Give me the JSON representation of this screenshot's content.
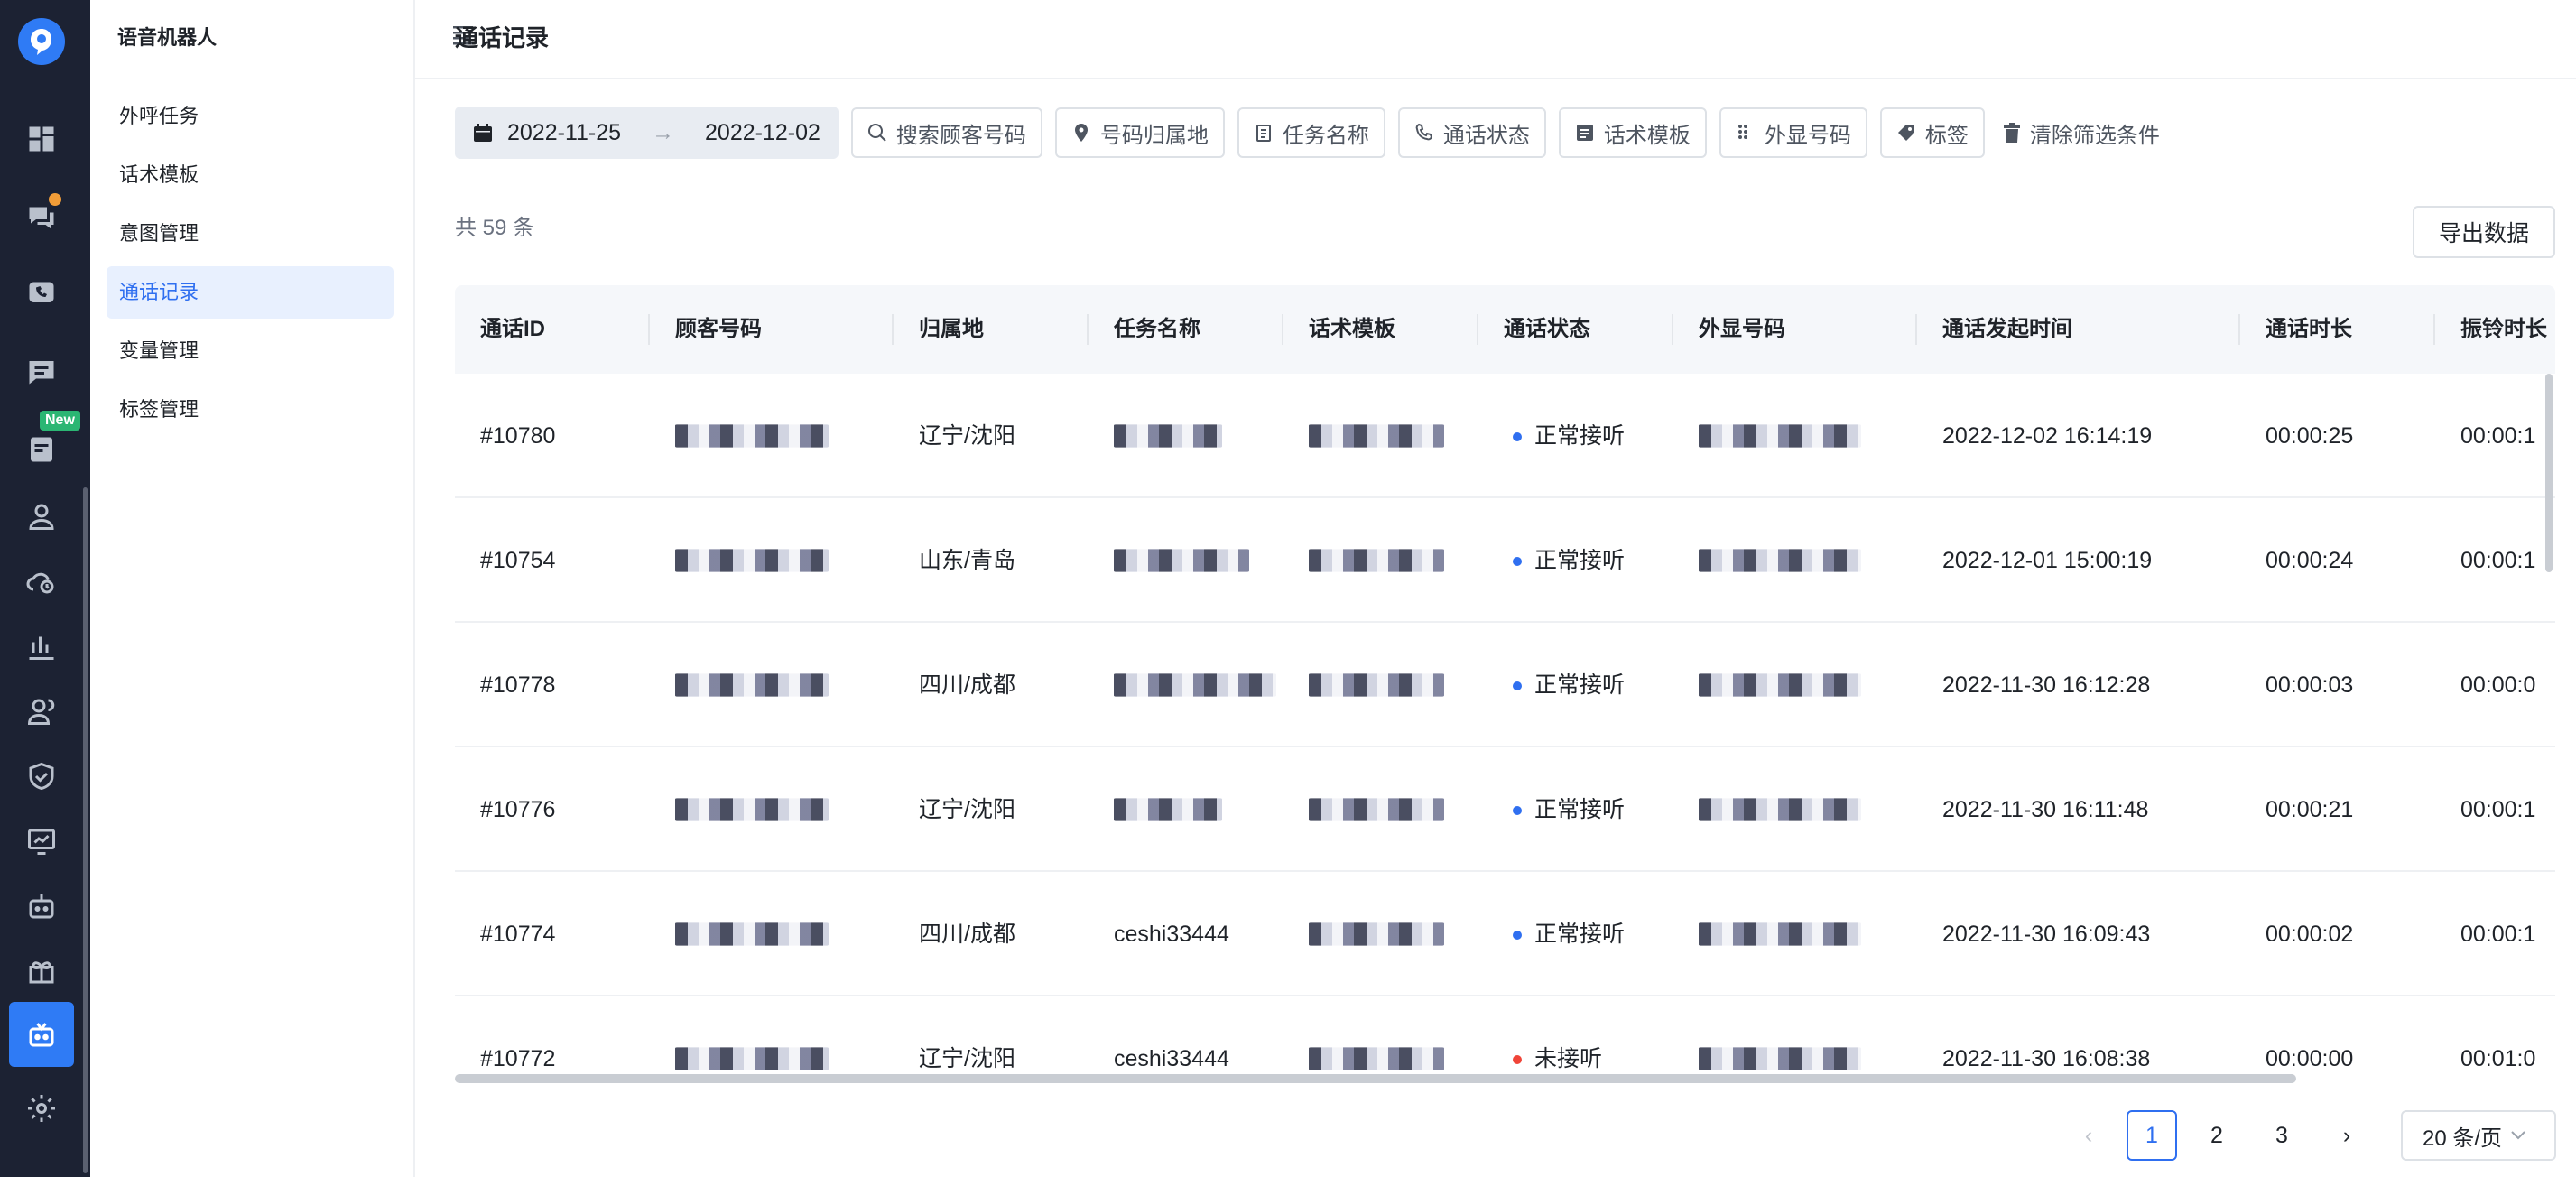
{
  "sidebar": {
    "app_title": "语音机器人",
    "items": [
      {
        "label": "外呼任务",
        "active": false
      },
      {
        "label": "话术模板",
        "active": false
      },
      {
        "label": "意图管理",
        "active": false
      },
      {
        "label": "通话记录",
        "active": true
      },
      {
        "label": "变量管理",
        "active": false
      },
      {
        "label": "标签管理",
        "active": false
      }
    ],
    "rail_badge_new": "New"
  },
  "page": {
    "title": "通话记录"
  },
  "filters": {
    "date_start": "2022-11-25",
    "date_sep": "→",
    "date_end": "2022-12-02",
    "chips": [
      "搜索顾客号码",
      "号码归属地",
      "任务名称",
      "通话状态",
      "话术模板",
      "外显号码",
      "标签"
    ],
    "clear": "清除筛选条件"
  },
  "summary": {
    "count_text": "共 59 条",
    "export_label": "导出数据"
  },
  "table": {
    "headers": [
      "通话ID",
      "顾客号码",
      "归属地",
      "任务名称",
      "话术模板",
      "通话状态",
      "外显号码",
      "通话发起时间",
      "通话时长",
      "振铃时长"
    ],
    "rows": [
      {
        "id": "#10780",
        "location": "辽宁/沈阳",
        "task": "",
        "status": "正常接听",
        "status_color": "#2f6ff0",
        "time": "2022-12-02 16:14:19",
        "duration": "00:00:25",
        "ring": "00:00:1"
      },
      {
        "id": "#10754",
        "location": "山东/青岛",
        "task": "",
        "status": "正常接听",
        "status_color": "#2f6ff0",
        "time": "2022-12-01 15:00:19",
        "duration": "00:00:24",
        "ring": "00:00:1"
      },
      {
        "id": "#10778",
        "location": "四川/成都",
        "task": "",
        "status": "正常接听",
        "status_color": "#2f6ff0",
        "time": "2022-11-30 16:12:28",
        "duration": "00:00:03",
        "ring": "00:00:0"
      },
      {
        "id": "#10776",
        "location": "辽宁/沈阳",
        "task": "",
        "status": "正常接听",
        "status_color": "#2f6ff0",
        "time": "2022-11-30 16:11:48",
        "duration": "00:00:21",
        "ring": "00:00:1"
      },
      {
        "id": "#10774",
        "location": "四川/成都",
        "task": "ceshi33444",
        "status": "正常接听",
        "status_color": "#2f6ff0",
        "time": "2022-11-30 16:09:43",
        "duration": "00:00:02",
        "ring": "00:00:1"
      },
      {
        "id": "#10772",
        "location": "辽宁/沈阳",
        "task": "ceshi33444",
        "status": "未接听",
        "status_color": "#f04438",
        "time": "2022-11-30 16:08:38",
        "duration": "00:00:00",
        "ring": "00:01:0"
      }
    ]
  },
  "pagination": {
    "pages": [
      "1",
      "2",
      "3"
    ],
    "current": "1",
    "page_size": "20 条/页",
    "prev": "‹",
    "next": "›"
  }
}
